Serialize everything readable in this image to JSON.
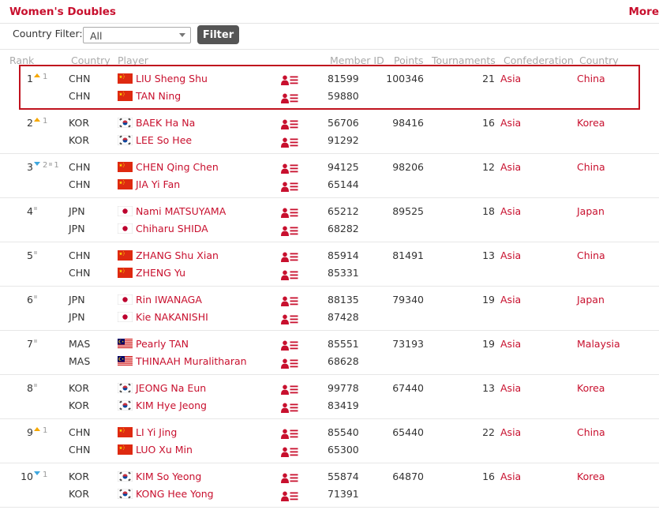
{
  "header": {
    "title": "Women's Doubles",
    "more": "More"
  },
  "filter": {
    "label": "Country Filter:",
    "value": "All",
    "button": "Filter"
  },
  "columns": {
    "rank": "Rank",
    "country": "Country",
    "player": "Player",
    "member_id": "Member ID",
    "points": "Points",
    "tournaments": "Tournaments",
    "confederation": "Confederation",
    "country_name": "Country"
  },
  "colors": {
    "accent": "#c8102e",
    "up": "#f6a800",
    "down": "#3ea7de",
    "highlight": "#c0121e"
  },
  "rows": [
    {
      "rank": "1",
      "move": {
        "dir": "up",
        "n": "1"
      },
      "points": "100346",
      "tournaments": "21",
      "confederation": "Asia",
      "country_name": "China",
      "highlight": true,
      "players": [
        {
          "code": "CHN",
          "flag": "china-flag-icon",
          "name": "LIU Sheng Shu",
          "member_id": "81599"
        },
        {
          "code": "CHN",
          "flag": "china-flag-icon",
          "name": "TAN Ning",
          "member_id": "59880"
        }
      ]
    },
    {
      "rank": "2",
      "move": {
        "dir": "up",
        "n": "1"
      },
      "points": "98416",
      "tournaments": "16",
      "confederation": "Asia",
      "country_name": "Korea",
      "players": [
        {
          "code": "KOR",
          "flag": "korea-flag-icon",
          "name": "BAEK Ha Na",
          "member_id": "56706"
        },
        {
          "code": "KOR",
          "flag": "korea-flag-icon",
          "name": "LEE So Hee",
          "member_id": "91292"
        }
      ]
    },
    {
      "rank": "3",
      "move": {
        "dir": "down",
        "n": "2",
        "extra": "1"
      },
      "points": "98206",
      "tournaments": "12",
      "confederation": "Asia",
      "country_name": "China",
      "players": [
        {
          "code": "CHN",
          "flag": "china-flag-icon",
          "name": "CHEN Qing Chen",
          "member_id": "94125"
        },
        {
          "code": "CHN",
          "flag": "china-flag-icon",
          "name": "JIA Yi Fan",
          "member_id": "65144"
        }
      ]
    },
    {
      "rank": "4",
      "move": {
        "dir": "same",
        "n": ""
      },
      "points": "89525",
      "tournaments": "18",
      "confederation": "Asia",
      "country_name": "Japan",
      "players": [
        {
          "code": "JPN",
          "flag": "japan-flag-icon",
          "name": "Nami MATSUYAMA",
          "member_id": "65212"
        },
        {
          "code": "JPN",
          "flag": "japan-flag-icon",
          "name": "Chiharu SHIDA",
          "member_id": "68282"
        }
      ]
    },
    {
      "rank": "5",
      "move": {
        "dir": "same",
        "n": ""
      },
      "points": "81491",
      "tournaments": "13",
      "confederation": "Asia",
      "country_name": "China",
      "players": [
        {
          "code": "CHN",
          "flag": "china-flag-icon",
          "name": "ZHANG Shu Xian",
          "member_id": "85914"
        },
        {
          "code": "CHN",
          "flag": "china-flag-icon",
          "name": "ZHENG Yu",
          "member_id": "85331"
        }
      ]
    },
    {
      "rank": "6",
      "move": {
        "dir": "same",
        "n": ""
      },
      "points": "79340",
      "tournaments": "19",
      "confederation": "Asia",
      "country_name": "Japan",
      "players": [
        {
          "code": "JPN",
          "flag": "japan-flag-icon",
          "name": "Rin IWANAGA",
          "member_id": "88135"
        },
        {
          "code": "JPN",
          "flag": "japan-flag-icon",
          "name": "Kie NAKANISHI",
          "member_id": "87428"
        }
      ]
    },
    {
      "rank": "7",
      "move": {
        "dir": "same",
        "n": ""
      },
      "points": "73193",
      "tournaments": "19",
      "confederation": "Asia",
      "country_name": "Malaysia",
      "players": [
        {
          "code": "MAS",
          "flag": "malaysia-flag-icon",
          "name": "Pearly TAN",
          "member_id": "85551"
        },
        {
          "code": "MAS",
          "flag": "malaysia-flag-icon",
          "name": "THINAAH Muralitharan",
          "member_id": "68628"
        }
      ]
    },
    {
      "rank": "8",
      "move": {
        "dir": "same",
        "n": ""
      },
      "points": "67440",
      "tournaments": "13",
      "confederation": "Asia",
      "country_name": "Korea",
      "players": [
        {
          "code": "KOR",
          "flag": "korea-flag-icon",
          "name": "JEONG Na Eun",
          "member_id": "99778"
        },
        {
          "code": "KOR",
          "flag": "korea-flag-icon",
          "name": "KIM Hye Jeong",
          "member_id": "83419"
        }
      ]
    },
    {
      "rank": "9",
      "move": {
        "dir": "up",
        "n": "1"
      },
      "points": "65440",
      "tournaments": "22",
      "confederation": "Asia",
      "country_name": "China",
      "players": [
        {
          "code": "CHN",
          "flag": "china-flag-icon",
          "name": "LI Yi Jing",
          "member_id": "85540"
        },
        {
          "code": "CHN",
          "flag": "china-flag-icon",
          "name": "LUO Xu Min",
          "member_id": "65300"
        }
      ]
    },
    {
      "rank": "10",
      "move": {
        "dir": "down",
        "n": "1"
      },
      "points": "64870",
      "tournaments": "16",
      "confederation": "Asia",
      "country_name": "Korea",
      "players": [
        {
          "code": "KOR",
          "flag": "korea-flag-icon",
          "name": "KIM So Yeong",
          "member_id": "55874"
        },
        {
          "code": "KOR",
          "flag": "korea-flag-icon",
          "name": "KONG Hee Yong",
          "member_id": "71391"
        }
      ]
    }
  ]
}
